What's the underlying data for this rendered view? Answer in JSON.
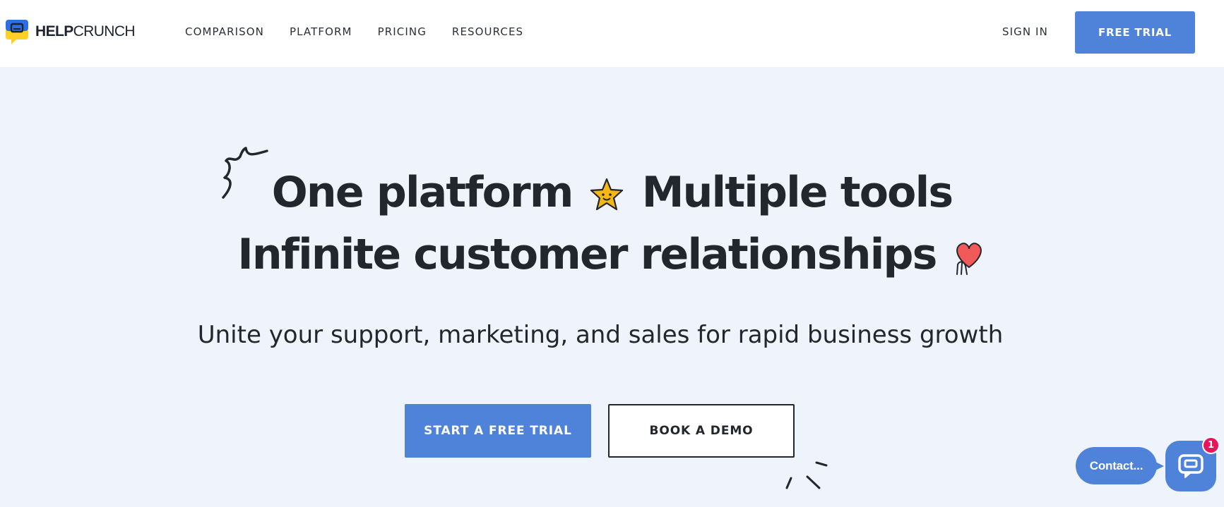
{
  "brand": {
    "name_bold": "HELP",
    "name_regular": "CRUNCH",
    "colors": {
      "primary": "#4f82d9",
      "hero_bg": "#eff4fc",
      "text": "#22262d",
      "badge": "#e8155a",
      "logo_yellow": "#fcd026",
      "logo_blue": "#2f6fe4"
    }
  },
  "header": {
    "nav": [
      {
        "label": "COMPARISON"
      },
      {
        "label": "PLATFORM"
      },
      {
        "label": "PRICING"
      },
      {
        "label": "RESOURCES"
      }
    ],
    "sign_in_label": "SIGN IN",
    "free_trial_label": "FREE TRIAL"
  },
  "hero": {
    "title_line1_a": "One platform",
    "title_line1_b": "Multiple tools",
    "title_line2": "Infinite customer relationships",
    "subtitle": "Unite your support, marketing, and sales for rapid business growth",
    "primary_cta": "START A FREE TRIAL",
    "secondary_cta": "BOOK A DEMO",
    "icons": [
      "squiggle-doodle",
      "star-face-icon",
      "heart-hand-icon",
      "sparkle-dashes"
    ]
  },
  "chat_widget": {
    "bubble_label": "Contact...",
    "badge_count": "1",
    "icon": "chat-icon"
  }
}
